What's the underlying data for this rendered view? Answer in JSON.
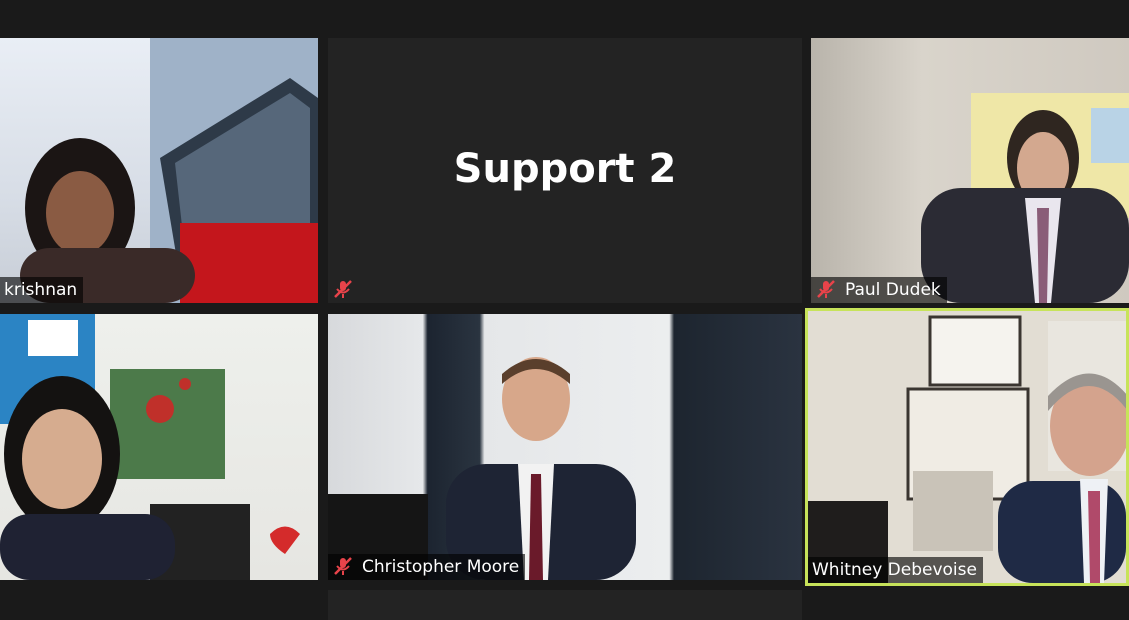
{
  "tiles": [
    {
      "name": "krishnan",
      "label": "krishnan",
      "muted": false
    },
    {
      "name": "support-2",
      "title": "Support 2",
      "muted": true
    },
    {
      "name": "paul-dudek",
      "label": "Paul Dudek",
      "muted": true
    },
    {
      "name": "participant-4",
      "label": "",
      "muted": false
    },
    {
      "name": "christopher-moore",
      "label": "Christopher Moore",
      "muted": true
    },
    {
      "name": "whitney-debevoise",
      "label": "Whitney Debevoise",
      "muted": false,
      "active_speaker": true
    }
  ],
  "colors": {
    "active_speaker_border": "#c7e35a",
    "mute_icon": "#e8434a"
  },
  "icons": {
    "mute": "mic-muted-icon"
  }
}
